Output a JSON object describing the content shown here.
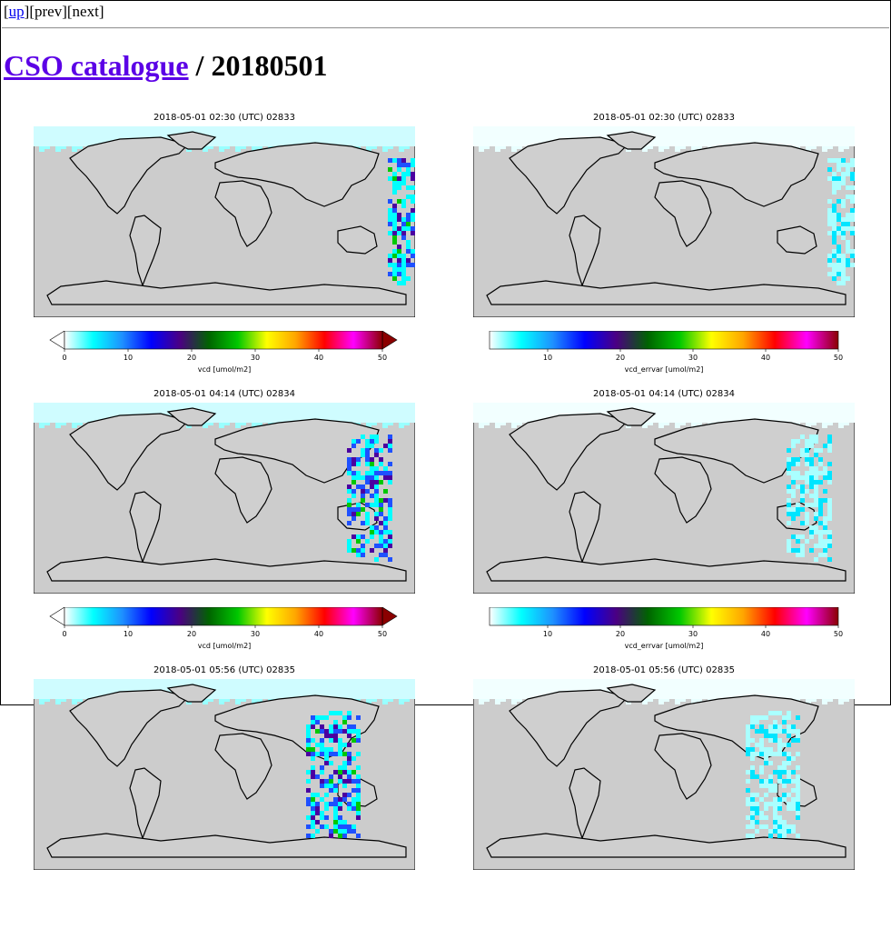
{
  "nav": {
    "up": "up",
    "prev": "prev",
    "next": "next"
  },
  "header": {
    "link_text": "CSO catalogue",
    "title_suffix": " / 20180501"
  },
  "figures": [
    {
      "title": "2018-05-01 02:30 (UTC) 02833",
      "variable": "vcd [umol/m2]",
      "ticks": [
        "0",
        "10",
        "20",
        "30",
        "40",
        "50"
      ],
      "kind": "vcd",
      "swath": "e1"
    },
    {
      "title": "2018-05-01 02:30 (UTC) 02833",
      "variable": "vcd_errvar [umol/m2]",
      "ticks": [
        "10",
        "20",
        "30",
        "40",
        "50"
      ],
      "kind": "err",
      "swath": "e1"
    },
    {
      "title": "2018-05-01 04:14 (UTC) 02834",
      "variable": "vcd [umol/m2]",
      "ticks": [
        "0",
        "10",
        "20",
        "30",
        "40",
        "50"
      ],
      "kind": "vcd",
      "swath": "e2"
    },
    {
      "title": "2018-05-01 04:14 (UTC) 02834",
      "variable": "vcd_errvar [umol/m2]",
      "ticks": [
        "10",
        "20",
        "30",
        "40",
        "50"
      ],
      "kind": "err",
      "swath": "e2"
    },
    {
      "title": "2018-05-01 05:56 (UTC) 02835",
      "variable": "",
      "ticks": [],
      "kind": "vcd",
      "swath": "e3"
    },
    {
      "title": "2018-05-01 05:56 (UTC) 02835",
      "variable": "",
      "ticks": [],
      "kind": "err",
      "swath": "e3"
    }
  ],
  "colors": {
    "land": "#cfcfcf",
    "ocean": "#cccccc",
    "coast": "#000000",
    "link": "#0000ee",
    "header_link": "#5b00e6",
    "cmap": [
      "#ffffff",
      "#00ffff",
      "#1e90ff",
      "#0000ff",
      "#4b0082",
      "#006400",
      "#00c800",
      "#ffff00",
      "#ffa500",
      "#ff0000",
      "#ff00ff",
      "#8b0000"
    ]
  }
}
